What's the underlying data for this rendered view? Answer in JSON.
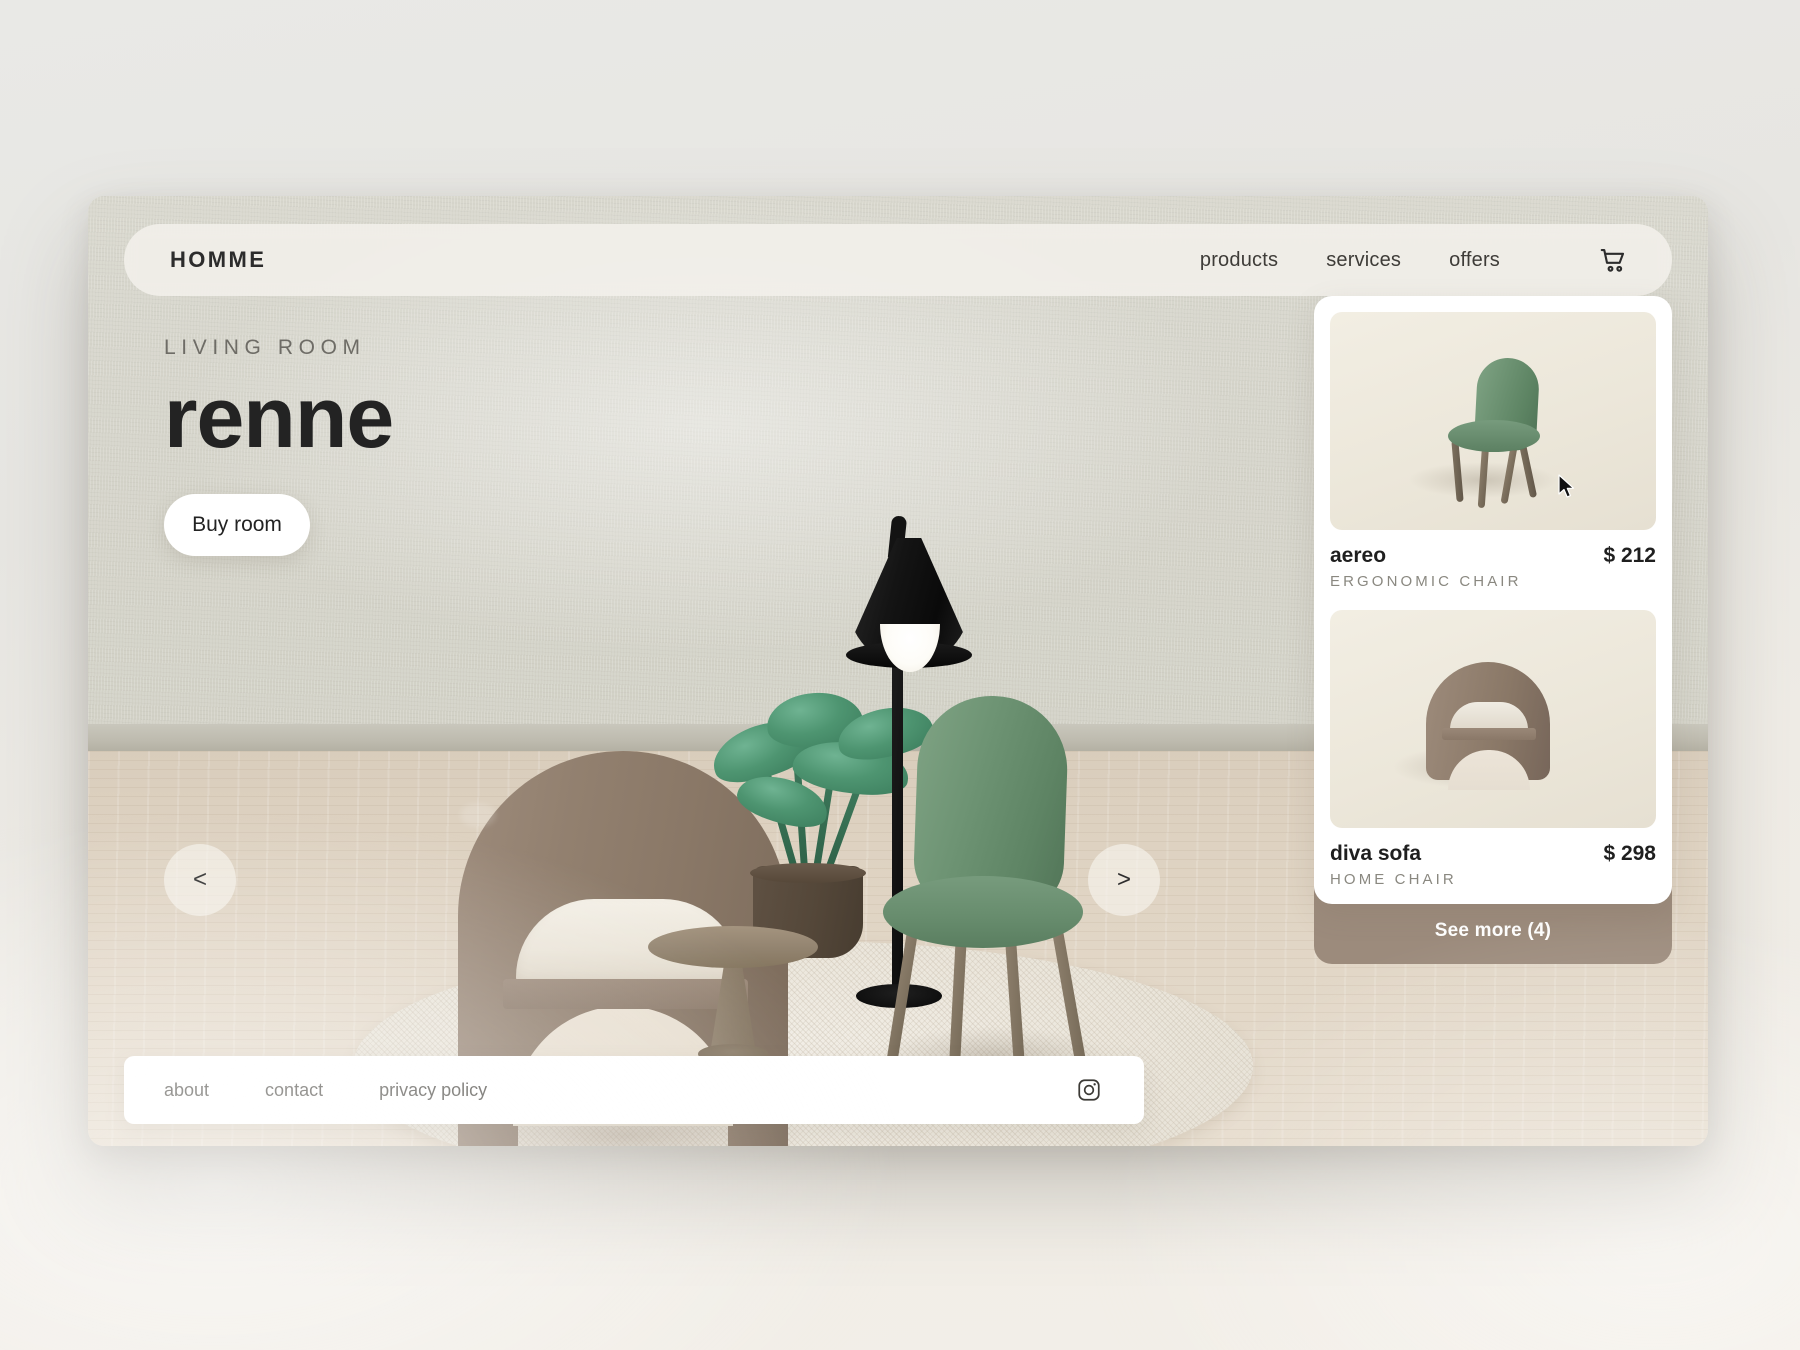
{
  "brand": {
    "logo": "HOMME"
  },
  "nav": {
    "links": [
      {
        "label": "products"
      },
      {
        "label": "services"
      },
      {
        "label": "offers"
      }
    ],
    "cart_icon": "shopping-cart-icon"
  },
  "hero": {
    "eyebrow": "LIVING ROOM",
    "headline": "renne",
    "cta_label": "Buy room"
  },
  "carousel": {
    "prev_label": "<",
    "next_label": ">"
  },
  "panel": {
    "products": [
      {
        "name": "aereo",
        "price": "$ 212",
        "category": "ERGONOMIC CHAIR",
        "thumb": "green-dining-chair"
      },
      {
        "name": "diva sofa",
        "price": "$ 298",
        "category": "HOME CHAIR",
        "thumb": "brown-barrel-armchair"
      }
    ],
    "see_more_label": "See more (4)"
  },
  "footer": {
    "links": [
      {
        "label": "about"
      },
      {
        "label": "contact"
      },
      {
        "label": "privacy policy"
      }
    ],
    "social_icon": "instagram-icon"
  },
  "colors": {
    "wall": "#d5d4ca",
    "floor": "#e0d5c4",
    "accent_taupe": "#9c8b7c",
    "chair_green": "#688d6e",
    "chair_brown": "#8d7b6b",
    "text_dark": "#232323",
    "text_muted": "#8a8880",
    "card_white": "#ffffff"
  }
}
